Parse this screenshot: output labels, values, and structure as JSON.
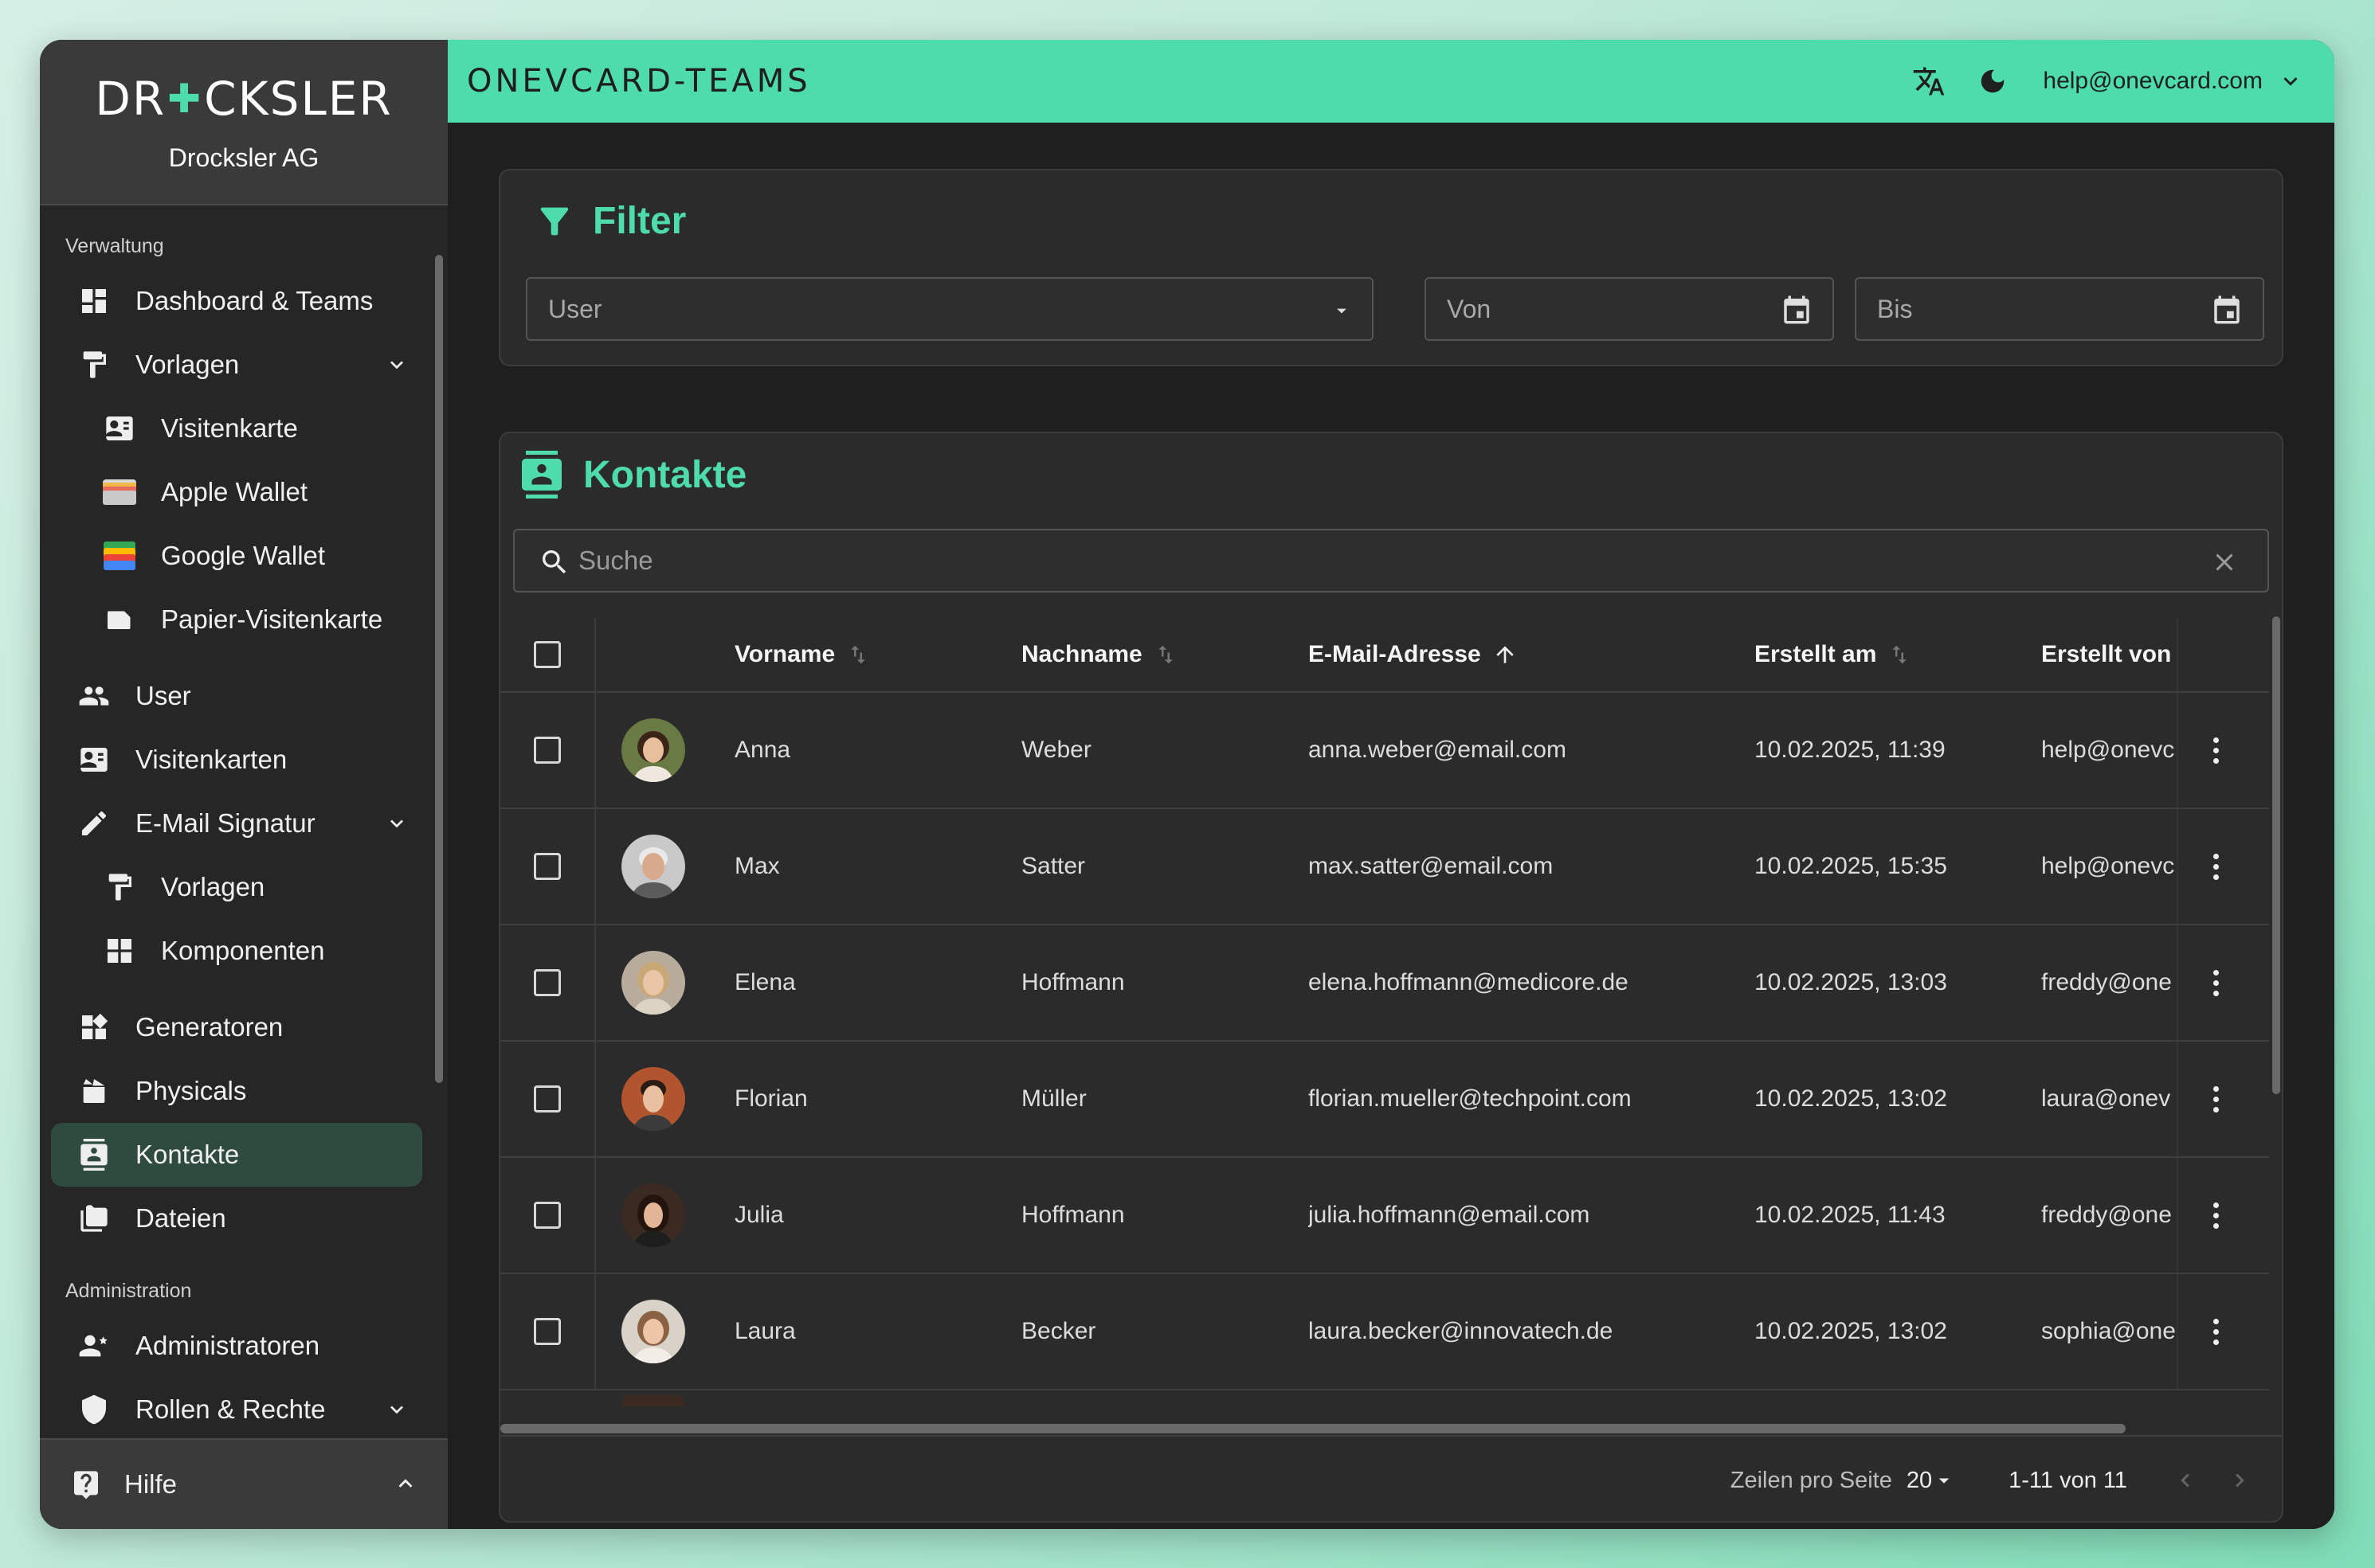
{
  "brand": {
    "logo_text": "DR",
    "logo_text_end": "CKSLER",
    "company": "Drocksler AG"
  },
  "topbar": {
    "product": "ONEVCARD-TEAMS",
    "user_email": "help@onevcard.com"
  },
  "colors": {
    "accent": "#4fdcac",
    "sidebar_bg": "#262626",
    "card_bg": "#2b2b2b",
    "active_bg": "#2f4a3e"
  },
  "sidebar": {
    "section_verwaltung": "Verwaltung",
    "section_administration": "Administration",
    "items": [
      {
        "label": "Dashboard & Teams",
        "icon": "dashboard-icon"
      },
      {
        "label": "Vorlagen",
        "icon": "paint-roller-icon"
      },
      {
        "label": "Visitenkarte",
        "icon": "contact-card-icon"
      },
      {
        "label": "Apple Wallet",
        "icon": "apple-wallet-icon"
      },
      {
        "label": "Google Wallet",
        "icon": "google-wallet-icon"
      },
      {
        "label": "Papier-Visitenkarte",
        "icon": "paper-card-icon"
      },
      {
        "label": "User",
        "icon": "users-icon"
      },
      {
        "label": "Visitenkarten",
        "icon": "contact-card-icon"
      },
      {
        "label": "E-Mail Signatur",
        "icon": "signature-icon"
      },
      {
        "label": "Vorlagen",
        "icon": "paint-roller-icon"
      },
      {
        "label": "Komponenten",
        "icon": "components-icon"
      },
      {
        "label": "Generatoren",
        "icon": "widgets-icon"
      },
      {
        "label": "Physicals",
        "icon": "physicals-icon"
      },
      {
        "label": "Kontakte",
        "icon": "contacts-icon"
      },
      {
        "label": "Dateien",
        "icon": "folder-icon"
      },
      {
        "label": "Administratoren",
        "icon": "admin-icon"
      },
      {
        "label": "Rollen & Rechte",
        "icon": "roles-icon"
      }
    ],
    "help": "Hilfe"
  },
  "filter": {
    "title": "Filter",
    "user_placeholder": "User",
    "from_placeholder": "Von",
    "to_placeholder": "Bis"
  },
  "contacts": {
    "title": "Kontakte",
    "search_placeholder": "Suche",
    "columns": [
      "Vorname",
      "Nachname",
      "E-Mail-Adresse",
      "Erstellt am",
      "Erstellt von"
    ],
    "rows": [
      {
        "first": "Anna",
        "last": "Weber",
        "email": "anna.weber@email.com",
        "created": "10.02.2025, 11:39",
        "by": "help@onevc"
      },
      {
        "first": "Max",
        "last": "Satter",
        "email": "max.satter@email.com",
        "created": "10.02.2025, 15:35",
        "by": "help@onevc"
      },
      {
        "first": "Elena",
        "last": "Hoffmann",
        "email": "elena.hoffmann@medicore.de",
        "created": "10.02.2025, 13:03",
        "by": "freddy@one"
      },
      {
        "first": "Florian",
        "last": "Müller",
        "email": "florian.mueller@techpoint.com",
        "created": "10.02.2025, 13:02",
        "by": "laura@onev"
      },
      {
        "first": "Julia",
        "last": "Hoffmann",
        "email": "julia.hoffmann@email.com",
        "created": "10.02.2025, 11:43",
        "by": "freddy@one"
      },
      {
        "first": "Laura",
        "last": "Becker",
        "email": "laura.becker@innovatech.de",
        "created": "10.02.2025, 13:02",
        "by": "sophia@one"
      }
    ],
    "footer": {
      "rows_per_page_label": "Zeilen pro Seite",
      "rows_per_page": "20",
      "range": "1-11 von 11"
    }
  }
}
